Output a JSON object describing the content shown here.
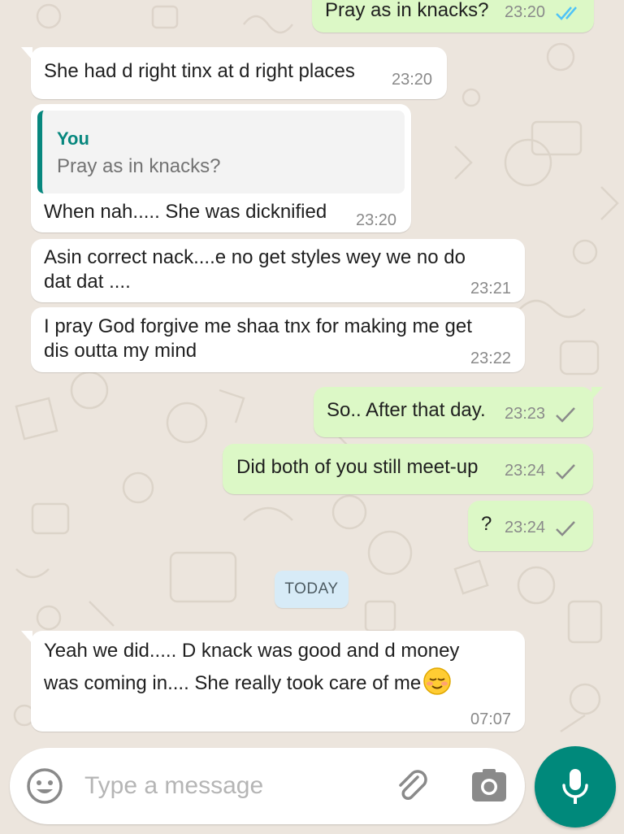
{
  "colors": {
    "incoming": "#ffffff",
    "outgoing": "#dcf8c6",
    "accent": "#00897b",
    "quote_bar": "#07877e",
    "read_tick": "#4fc3f7"
  },
  "messages": [
    {
      "id": "m1",
      "dir": "out",
      "lines": [
        "Pray as in knacks?"
      ],
      "time": "23:20",
      "status": "read"
    },
    {
      "id": "m2",
      "dir": "in",
      "lines": [
        "She had d right tinx at d right places"
      ],
      "time": "23:20"
    },
    {
      "id": "m3",
      "dir": "in",
      "quote": {
        "author": "You",
        "text": "Pray as in knacks?"
      },
      "lines": [
        "When nah..... She was dicknified"
      ],
      "time": "23:20"
    },
    {
      "id": "m4",
      "dir": "in",
      "lines": [
        "Asin correct nack....e no get styles wey we no do",
        "dat dat ...."
      ],
      "time": "23:21"
    },
    {
      "id": "m5",
      "dir": "in",
      "lines": [
        "I pray God forgive me shaa tnx for making me get",
        "dis outta my mind"
      ],
      "time": "23:22"
    },
    {
      "id": "m6",
      "dir": "out",
      "lines": [
        "So.. After that day."
      ],
      "time": "23:23",
      "status": "sent"
    },
    {
      "id": "m7",
      "dir": "out",
      "lines": [
        "Did both of you still meet-up"
      ],
      "time": "23:24",
      "status": "sent"
    },
    {
      "id": "m8",
      "dir": "out",
      "lines": [
        "?"
      ],
      "time": "23:24",
      "status": "sent"
    },
    {
      "id": "m9",
      "dir": "in",
      "lines": [
        "Yeah we did..... D knack was good and d money",
        "was coming in.... She really took care of me"
      ],
      "emoji": "relieved-face",
      "time": "07:07"
    }
  ],
  "day_separator": "TODAY",
  "composer": {
    "placeholder": "Type a message",
    "icons": [
      "emoji-icon",
      "attach-icon",
      "camera-icon",
      "mic-icon"
    ]
  }
}
